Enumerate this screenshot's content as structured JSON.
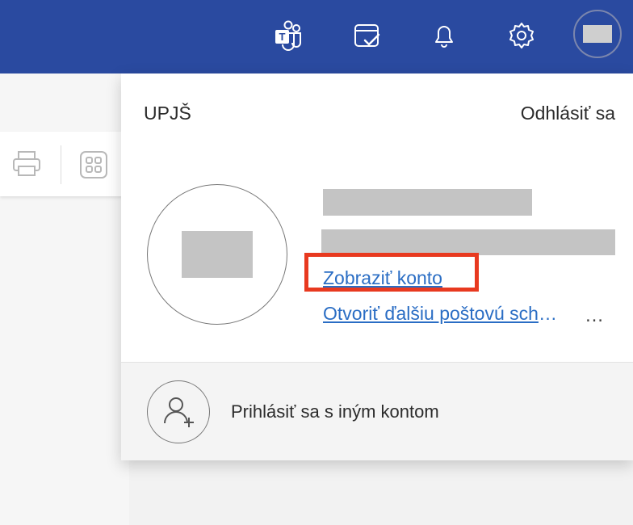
{
  "header": {
    "icons": [
      "teams-icon",
      "calendar-check-icon",
      "bell-icon",
      "gear-icon",
      "avatar"
    ],
    "teams_letter": "T"
  },
  "account_panel": {
    "organization": "UPJŠ",
    "sign_out": "Odhlásiť sa",
    "view_account": "Zobraziť konto",
    "open_other_mailbox": "Otvoriť ďalšiu poštovú schránku",
    "more": "…",
    "sign_in_other": "Prihlásiť sa s iným kontom"
  },
  "colors": {
    "header_bg": "#2a4aa0",
    "link": "#2a6dc4",
    "highlight": "#e8391f"
  }
}
